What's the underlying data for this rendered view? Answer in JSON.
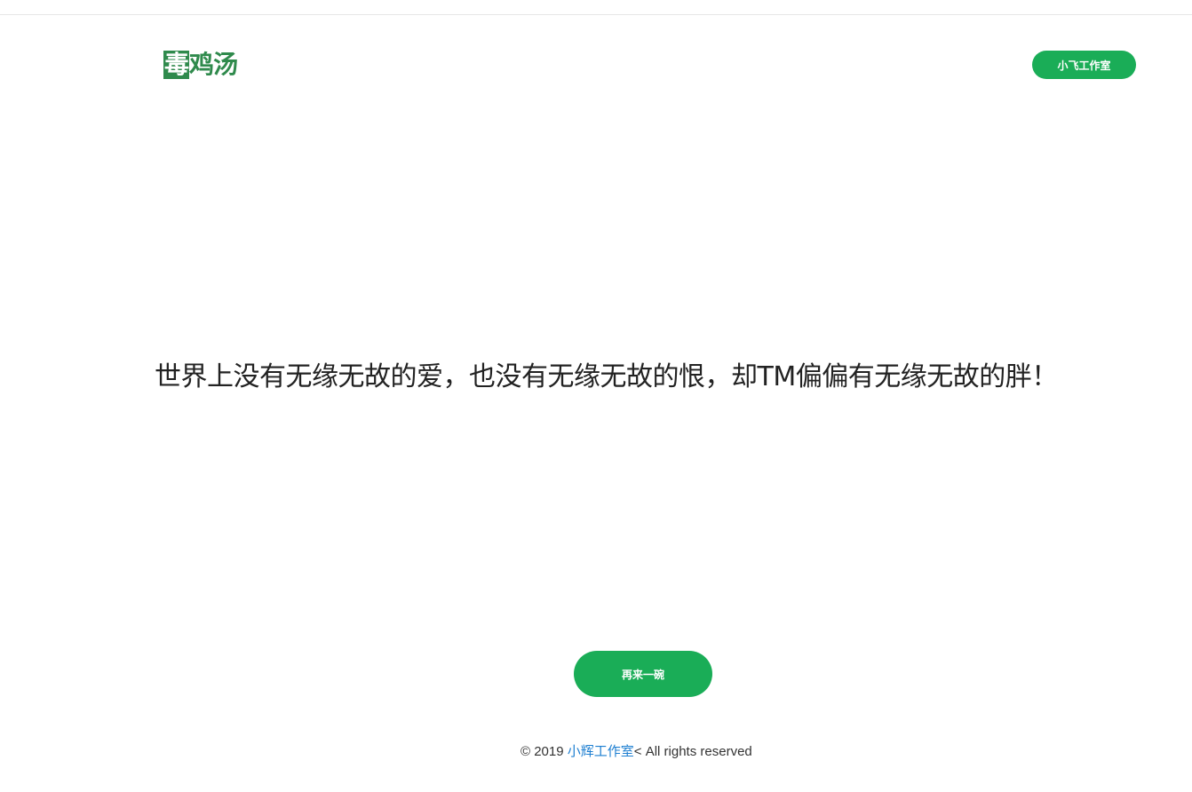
{
  "header": {
    "logo_first": "毒",
    "logo_rest": "鸡汤",
    "studio_button": "小飞工作室"
  },
  "main": {
    "quote": "世界上没有无缘无故的爱，也没有无缘无故的恨，却TM偏偏有无缘无故的胖！",
    "again_button": "再来一碗"
  },
  "footer": {
    "copyright_prefix": "© 2019 ",
    "studio_link": "小辉工作室",
    "copyright_suffix": "< All rights reserved"
  },
  "colors": {
    "accent": "#1aad57",
    "logo": "#2f8a4c",
    "link": "#1e7fd1"
  }
}
